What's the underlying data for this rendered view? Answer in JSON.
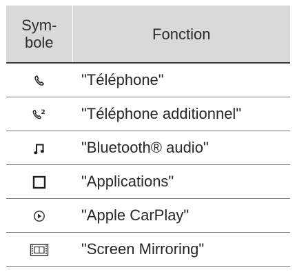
{
  "table": {
    "header": {
      "symbol_line1": "Sym-",
      "symbol_line2": "bole",
      "function": "Fonction"
    },
    "rows": [
      {
        "icon": "phone-icon",
        "function": "\"Téléphone\""
      },
      {
        "icon": "additional-phone-icon",
        "function": "\"Téléphone additionnel\""
      },
      {
        "icon": "music-note-icon",
        "function": "\"Bluetooth® audio\""
      },
      {
        "icon": "applications-square-icon",
        "function": "\"Applications\""
      },
      {
        "icon": "carplay-play-icon",
        "function": "\"Apple CarPlay\""
      },
      {
        "icon": "screen-mirroring-film-icon",
        "function": "\"Screen Mirroring\""
      }
    ]
  }
}
